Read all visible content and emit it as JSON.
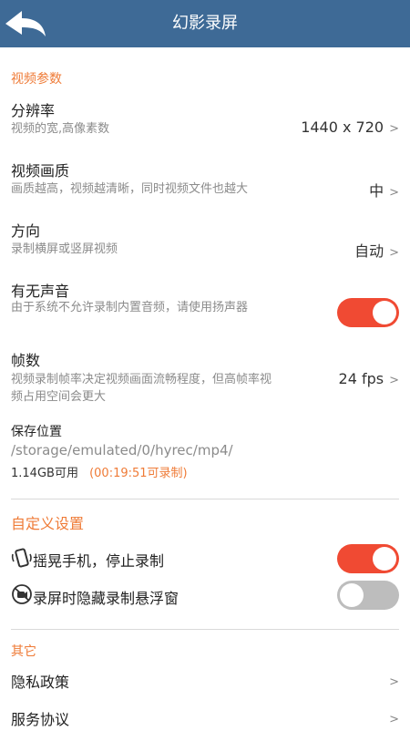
{
  "header": {
    "title": "幻影录屏"
  },
  "video": {
    "section": "视频参数",
    "resolution": {
      "label": "分辨率",
      "desc": "视频的宽,高像素数",
      "value": "1440 x 720"
    },
    "quality": {
      "label": "视频画质",
      "desc": "画质越高，视频越清晰，同时视频文件也越大",
      "value": "中"
    },
    "orientation": {
      "label": "方向",
      "desc": "录制横屏或竖屏视频",
      "value": "自动"
    },
    "audio": {
      "label": "有无声音",
      "desc": "由于系统不允许录制内置音频，请使用扬声器",
      "enabled": true
    },
    "fps": {
      "label": "帧数",
      "desc_line1": "视频录制帧率决定视频画面流畅程度，但高帧率视",
      "desc_line2": "频占用空间会更大",
      "value": "24 fps"
    },
    "storage": {
      "label": "保存位置",
      "path": "/storage/emulated/0/hyrec/mp4/",
      "available": "1.14GB可用",
      "remaining": "(00:19:51可录制)"
    }
  },
  "custom": {
    "section": "自定义设置",
    "shake": {
      "label": "摇晃手机，停止录制",
      "enabled": true,
      "icon": "shake-phone-icon"
    },
    "hide_float": {
      "label": "录屏时隐藏录制悬浮窗",
      "enabled": false,
      "icon": "hide-float-icon"
    }
  },
  "other": {
    "section": "其它",
    "privacy": {
      "label": "隐私政策"
    },
    "terms": {
      "label": "服务协议"
    }
  },
  "chevron": ">",
  "colors": {
    "header": "#3e6a96",
    "accent": "#ef7b37",
    "toggle_on": "#f04a33",
    "toggle_off": "#bdbdbd"
  }
}
